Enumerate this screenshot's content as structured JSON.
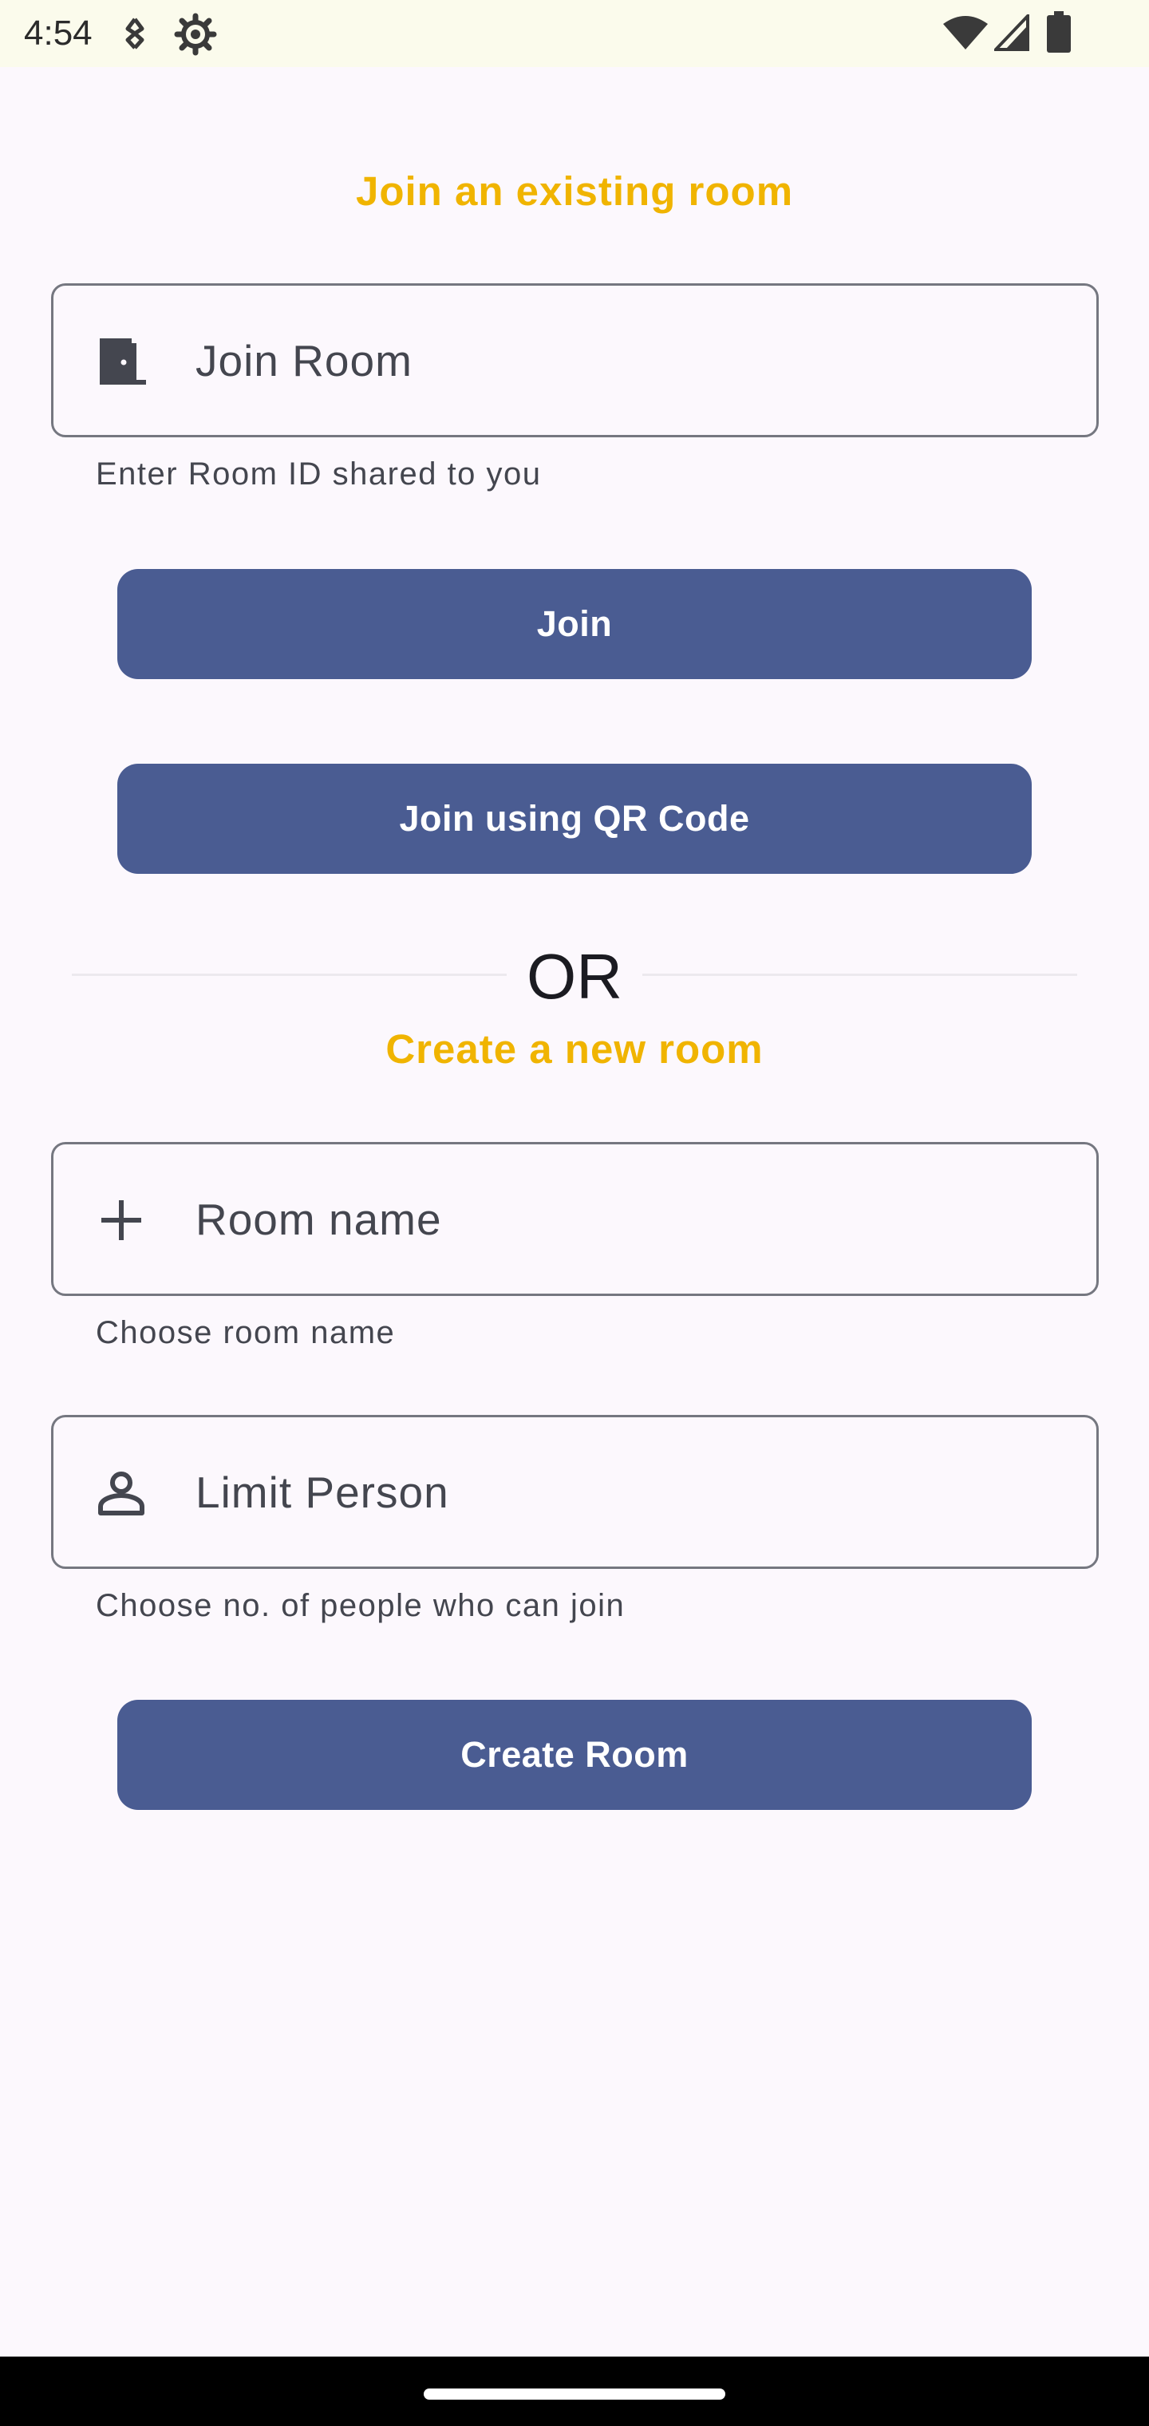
{
  "status_bar": {
    "time": "4:54",
    "icons": [
      "signal-vibrate-icon",
      "settings-gear-icon",
      "wifi-icon",
      "cell-signal-icon",
      "battery-icon"
    ]
  },
  "join_section": {
    "title": "Join an existing room",
    "input": {
      "label": "Join Room",
      "helper": "Enter Room ID shared to you",
      "icon": "door-icon"
    },
    "join_button": "Join",
    "qr_button": "Join using QR Code"
  },
  "divider": {
    "text": "OR"
  },
  "create_section": {
    "title": "Create a new room",
    "room_name_input": {
      "label": "Room name",
      "helper": "Choose room name",
      "icon": "plus-icon"
    },
    "limit_input": {
      "label": "Limit Person",
      "helper": "Choose no. of people who can join",
      "icon": "person-icon"
    },
    "create_button": "Create Room"
  },
  "colors": {
    "accent_title": "#f0b400",
    "button": "#4a5c92",
    "background": "#fcf8fd",
    "outline": "#757780"
  }
}
